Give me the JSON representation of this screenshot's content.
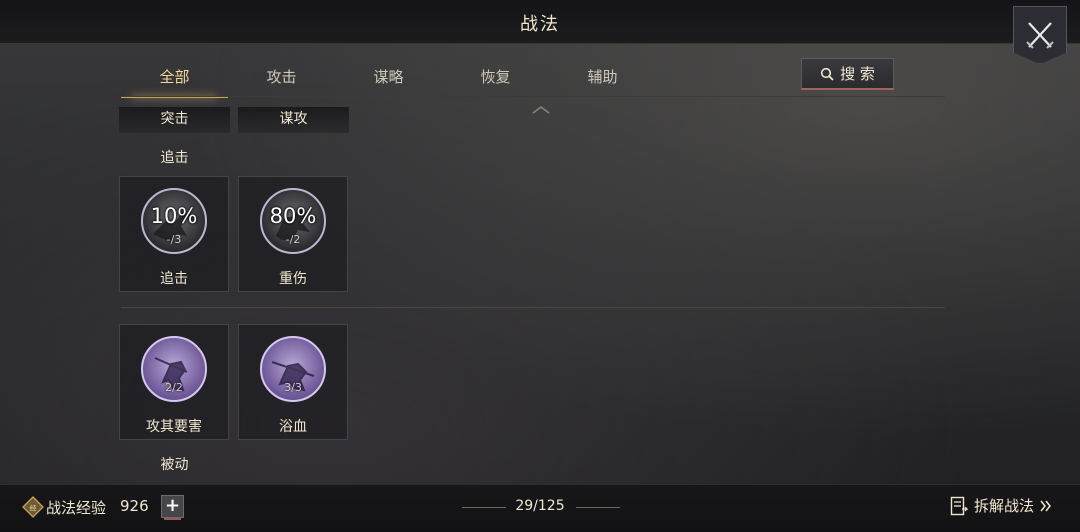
{
  "header": {
    "title": "战法"
  },
  "tabs": [
    {
      "label": "全部",
      "active": true
    },
    {
      "label": "攻击",
      "active": false
    },
    {
      "label": "谋略",
      "active": false
    },
    {
      "label": "恢复",
      "active": false
    },
    {
      "label": "辅助",
      "active": false
    }
  ],
  "search": {
    "label": "搜 索"
  },
  "groups": {
    "charge": "突击",
    "strategy_attack": "谋攻",
    "pursuit": "追击",
    "passive": "被动"
  },
  "cards": [
    {
      "name": "追击",
      "percent": "10%",
      "count": "-/3",
      "style": "dark"
    },
    {
      "name": "重伤",
      "percent": "80%",
      "count": "-/2",
      "style": "dark"
    },
    {
      "name": "攻其要害",
      "percent": "",
      "count": "2/2",
      "style": "purple"
    },
    {
      "name": "浴血",
      "percent": "",
      "count": "3/3",
      "style": "purple"
    }
  ],
  "footer": {
    "exp_label": "战法经验",
    "exp_value": "926",
    "pager": "29/125",
    "disassemble_label": "拆解战法"
  },
  "colors": {
    "accent": "#c8a358",
    "purple": "#8a72b8"
  }
}
